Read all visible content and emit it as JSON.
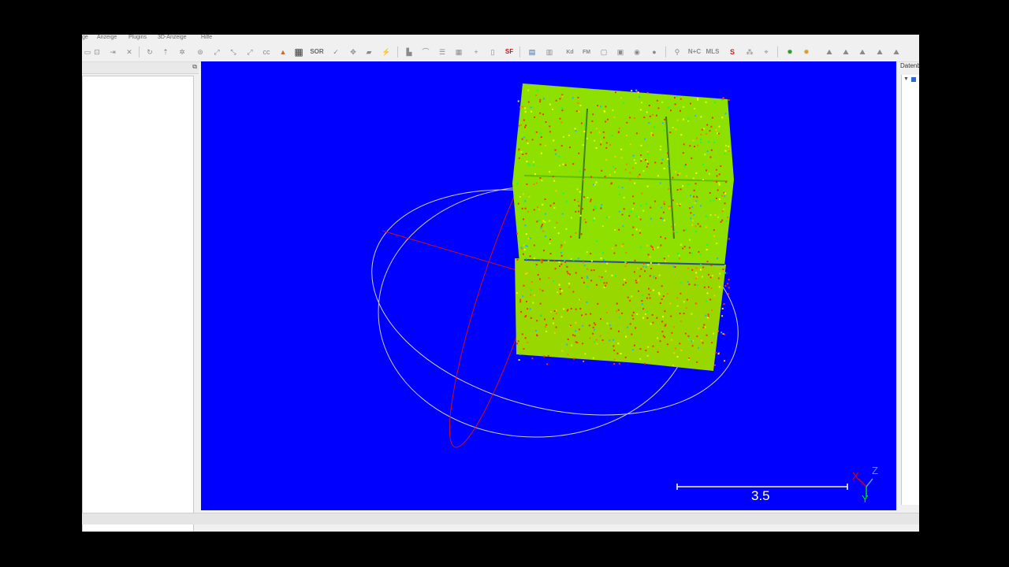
{
  "menu": [
    "ge",
    "Anzeige",
    "Plugins",
    "3D-Anzeige",
    "Hilfe"
  ],
  "toolbar": {
    "sf_label": "SF",
    "sor_label": "SOR",
    "nc_label": "N+C",
    "mls_label": "MLS",
    "kd_label": "Kd",
    "fm_label": "FM"
  },
  "right_panel": {
    "header": "Datenbank"
  },
  "viewport": {
    "background": "#0000ff",
    "scale_label": "3.5",
    "axes": {
      "x": "X",
      "y": "Y",
      "z": "Z"
    }
  }
}
